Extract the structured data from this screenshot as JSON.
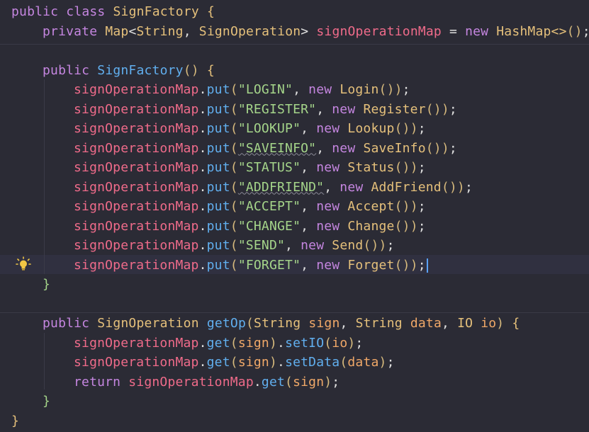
{
  "editor": {
    "language": "Java",
    "theme_background": "#2b2b35",
    "lines": {
      "l1": [
        "public",
        " ",
        "class",
        " ",
        "SignFactory",
        " ",
        "{"
      ],
      "l2": [
        "private",
        " ",
        "Map",
        "<",
        "String",
        ", ",
        "SignOperation",
        ">",
        " ",
        "signOperationMap",
        " = ",
        "new",
        " ",
        "HashMap",
        "<>",
        "(",
        ")",
        ";"
      ],
      "l4": [
        "public",
        " ",
        "SignFactory",
        "(",
        ")",
        " ",
        "{"
      ],
      "puts": [
        {
          "key": "\"LOGIN\"",
          "cls": "Login"
        },
        {
          "key": "\"REGISTER\"",
          "cls": "Register"
        },
        {
          "key": "\"LOOKUP\"",
          "cls": "Lookup"
        },
        {
          "key": "\"SAVEINFO\"",
          "cls": "SaveInfo"
        },
        {
          "key": "\"STATUS\"",
          "cls": "Status"
        },
        {
          "key": "\"ADDFRIEND\"",
          "cls": "AddFriend"
        },
        {
          "key": "\"ACCEPT\"",
          "cls": "Accept"
        },
        {
          "key": "\"CHANGE\"",
          "cls": "Change"
        },
        {
          "key": "\"SEND\"",
          "cls": "Send"
        },
        {
          "key": "\"FORGET\"",
          "cls": "Forget"
        }
      ],
      "field": "signOperationMap",
      "put": "put",
      "dot": ".",
      "new": "new",
      "close_ctor": "}",
      "l17": [
        "public",
        " ",
        "SignOperation",
        " ",
        "getOp",
        "(",
        "String",
        " ",
        "sign",
        ", ",
        "String",
        " ",
        "data",
        ", ",
        "IO",
        " ",
        "io",
        ")",
        " ",
        "{"
      ],
      "l18": [
        "signOperationMap",
        ".",
        "get",
        "(",
        "sign",
        ")",
        ".",
        "setIO",
        "(",
        "io",
        ")",
        ";"
      ],
      "l19": [
        "signOperationMap",
        ".",
        "get",
        "(",
        "sign",
        ")",
        ".",
        "setData",
        "(",
        "data",
        ")",
        ";"
      ],
      "l20": [
        "return",
        " ",
        "signOperationMap",
        ".",
        "get",
        "(",
        "sign",
        ")",
        ";"
      ],
      "close_method": "}",
      "close_class": "}"
    },
    "gutter_icon": "lightbulb-icon",
    "cursor_line": 14
  }
}
